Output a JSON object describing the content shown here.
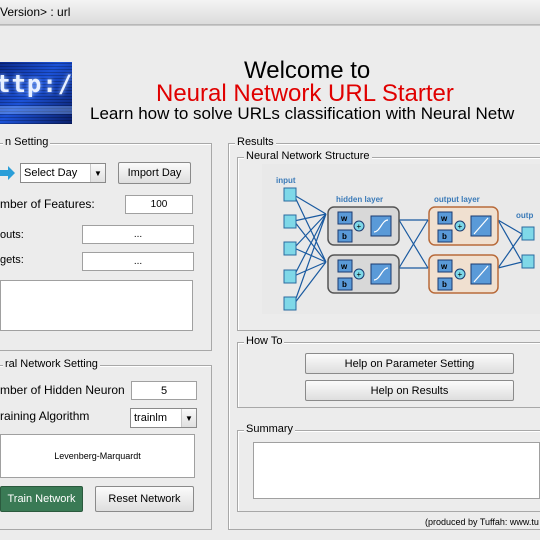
{
  "window": {
    "title": "Version> : url"
  },
  "header": {
    "welcome": "Welcome to",
    "app_name": "Neural Network URL Starter",
    "tagline": "Learn how to solve URLs classification with Neural Netw",
    "banner_text": "ttp://w"
  },
  "data_setting": {
    "legend": "n Setting",
    "select_value": "Select Day",
    "import_label": "Import Day",
    "features_label": "mber of Features:",
    "features_value": "100",
    "inputs_label": "outs:",
    "inputs_value": "...",
    "targets_label": "gets:",
    "targets_value": "..."
  },
  "nn_setting": {
    "legend": "ral Network Setting",
    "hidden_label": "mber of Hidden Neuron",
    "hidden_value": "5",
    "algo_label": "raining Algorithm",
    "algo_value": "trainlm",
    "algo_name": "Levenberg-Marquardt",
    "train_label": "Train Network",
    "reset_label": "Reset Network"
  },
  "results": {
    "legend": "Results",
    "structure_legend": "Neural Network Structure",
    "diagram": {
      "input": "input",
      "hidden": "hidden layer",
      "output_layer": "output layer",
      "output": "outp"
    },
    "howto_legend": "How To",
    "help_param": "Help on Parameter Setting",
    "help_results": "Help on Results",
    "summary_legend": "Summary"
  },
  "footer": {
    "credit": "(produced by Tuffah: www.tu"
  },
  "colors": {
    "accent_red": "#e00000",
    "train_green": "#3a7a55",
    "node_cyan": "#7fd8e8"
  }
}
